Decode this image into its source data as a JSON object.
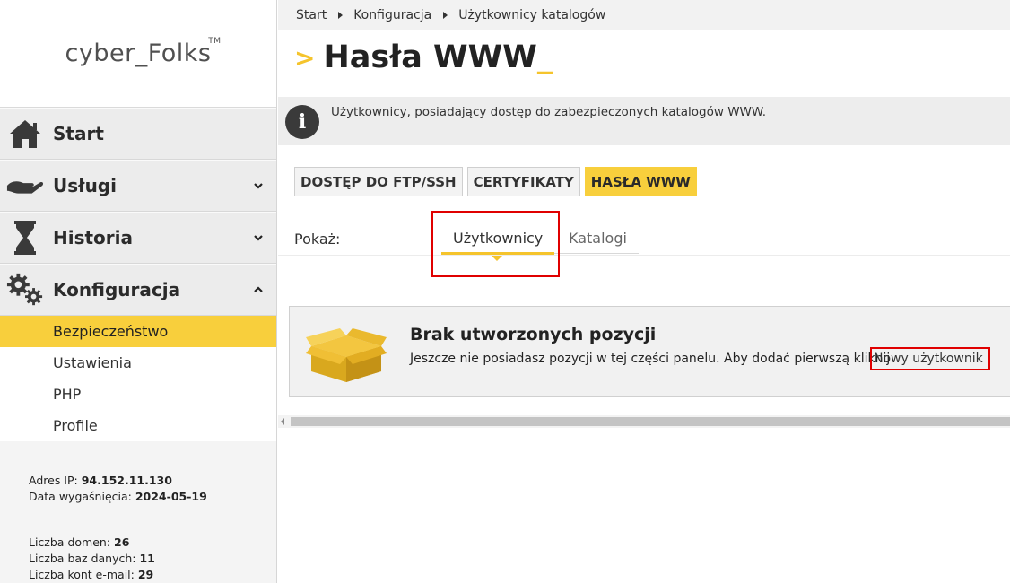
{
  "brand": {
    "name": "cyber_Folks",
    "tm": "TM"
  },
  "sidebar": {
    "nav": [
      {
        "label": "Start",
        "icon": "home-icon",
        "chevron": ""
      },
      {
        "label": "Usługi",
        "icon": "hand-services-icon",
        "chevron": "down"
      },
      {
        "label": "Historia",
        "icon": "hourglass-icon",
        "chevron": "down"
      },
      {
        "label": "Konfiguracja",
        "icon": "gears-icon",
        "chevron": "up"
      }
    ],
    "subitems": [
      {
        "label": "Bezpieczeństwo",
        "active": true
      },
      {
        "label": "Ustawienia",
        "active": false
      },
      {
        "label": "PHP",
        "active": false
      },
      {
        "label": "Profile",
        "active": false
      }
    ],
    "info": {
      "ip_label": "Adres IP:",
      "ip_value": "94.152.11.130",
      "exp_label": "Data wygaśnięcia:",
      "exp_value": "2024-05-19",
      "domains_label": "Liczba domen:",
      "domains_value": "26",
      "db_label": "Liczba baz danych:",
      "db_value": "11",
      "mail_label": "Liczba kont e-mail:",
      "mail_value": "29"
    }
  },
  "breadcrumb": [
    "Start",
    "Konfiguracja",
    "Użytkownicy katalogów"
  ],
  "page": {
    "title_prefix": ">",
    "title": "Hasła WWW",
    "title_cursor": "_",
    "info_text": "Użytkownicy, posiadający dostęp do zabezpieczonych katalogów WWW."
  },
  "tabs": [
    {
      "label": "DOSTĘP DO FTP/SSH",
      "active": false
    },
    {
      "label": "CERTYFIKATY",
      "active": false
    },
    {
      "label": "HASŁA WWW",
      "active": true
    }
  ],
  "filter": {
    "label": "Pokaż:",
    "options": [
      "Użytkownicy",
      "Katalogi"
    ],
    "selected": "Użytkownicy"
  },
  "empty_state": {
    "title": "Brak utworzonych pozycji",
    "description": "Jeszcze nie posiadasz pozycji w tej części panelu. Aby dodać pierwszą kliknij",
    "link": "Nowy użytkownik"
  },
  "colors": {
    "accent": "#f8cf3c",
    "highlight": "#e00000"
  }
}
